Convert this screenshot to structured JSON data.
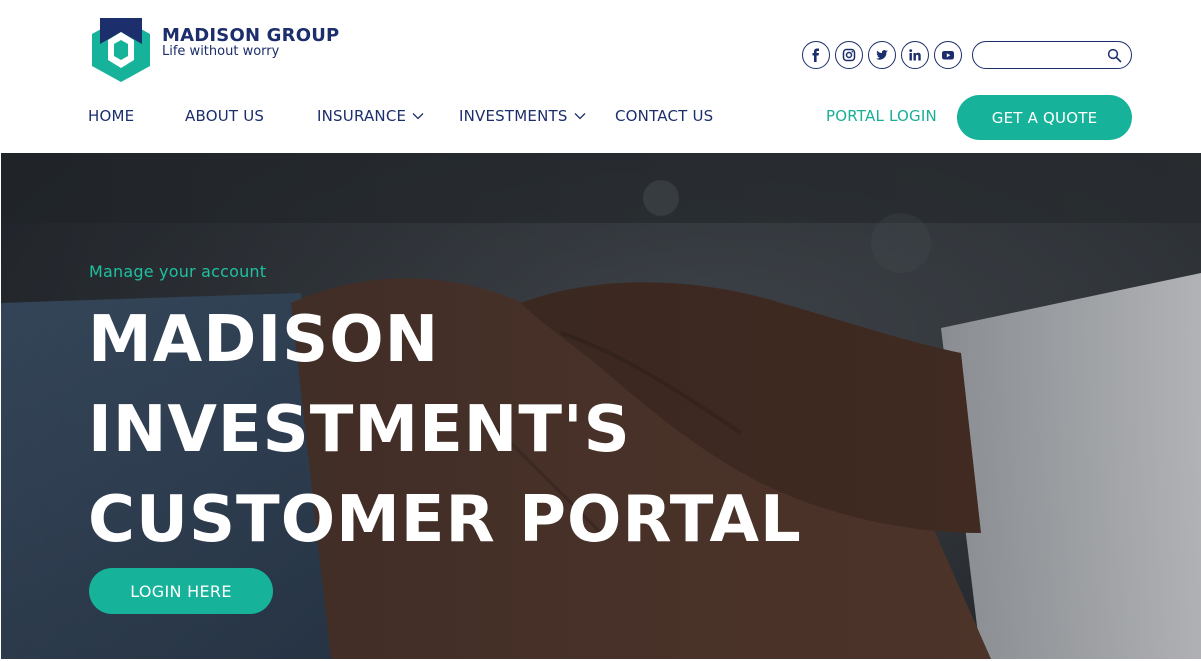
{
  "brand": {
    "name": "MADISON GROUP",
    "tagline": "Life without worry",
    "colors": {
      "navy": "#1c2e6b",
      "teal": "#16b29a"
    }
  },
  "social": [
    {
      "icon": "facebook-icon"
    },
    {
      "icon": "instagram-icon"
    },
    {
      "icon": "twitter-icon"
    },
    {
      "icon": "linkedin-icon"
    },
    {
      "icon": "youtube-icon"
    }
  ],
  "search": {
    "value": "",
    "placeholder": "",
    "icon": "search-icon"
  },
  "nav": {
    "items": [
      {
        "label": "HOME"
      },
      {
        "label": "ABOUT US"
      },
      {
        "label": "INSURANCE",
        "dropdown": true
      },
      {
        "label": "INVESTMENTS",
        "dropdown": true
      },
      {
        "label": "CONTACT US"
      }
    ],
    "portal_login": "PORTAL LOGIN",
    "quote_button": "GET A QUOTE"
  },
  "hero": {
    "kicker": "Manage your account",
    "headline_lines": [
      "MADISON",
      "INVESTMENT'S",
      "CUSTOMER PORTAL"
    ],
    "cta": "LOGIN HERE"
  }
}
